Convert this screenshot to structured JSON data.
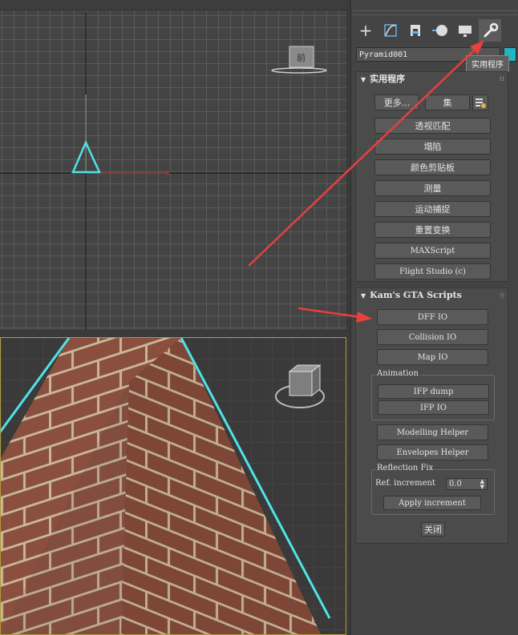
{
  "command_panel": {
    "tabs": [
      {
        "icon": "plus-icon",
        "glyph": "+"
      },
      {
        "icon": "modify-curve-icon",
        "glyph": "⌘"
      },
      {
        "icon": "hierarchy-icon",
        "glyph": "⊓"
      },
      {
        "icon": "motion-icon",
        "glyph": "●"
      },
      {
        "icon": "display-icon",
        "glyph": "▬"
      },
      {
        "icon": "wrench-icon",
        "glyph": "🔧"
      }
    ],
    "object_name": "Pyramid001",
    "object_color": "#22b5c2",
    "tooltip": "实用程序"
  },
  "utilities": {
    "title": "实用程序",
    "more_button": "更多...",
    "sets_button": "集",
    "buttons": [
      "透视匹配",
      "塌陷",
      "颜色剪贴板",
      "测量",
      "运动捕捉",
      "重置变换",
      "MAXScript",
      "Flight Studio (c)"
    ]
  },
  "kams": {
    "title": "Kam's GTA Scripts",
    "dff_io": "DFF IO",
    "collision_io": "Collision IO",
    "map_io": "Map IO",
    "animation_group": "Animation",
    "ifp_dump": "IFP dump",
    "ifp_io": "IFP IO",
    "modelling_helper": "Modelling Helper",
    "envelopes_helper": "Envelopes Helper",
    "reflection_group": "Reflection Fix",
    "ref_increment_label": "Ref. increment",
    "ref_increment_value": "0.0",
    "apply_increment": "Apply increment",
    "close_button": "关闭"
  },
  "viewport": {
    "axis_label": "x",
    "view_cube_label": "前"
  },
  "colors": {
    "selection": "#4fe3e8",
    "arrow": "#e8403a",
    "active_viewport_border": "#b09a3c"
  }
}
